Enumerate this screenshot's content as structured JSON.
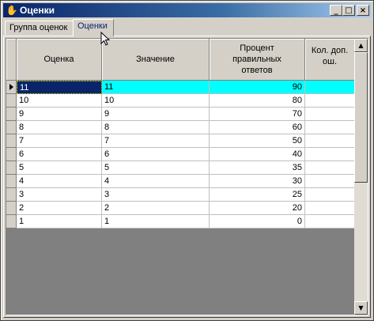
{
  "window": {
    "title": "Оценки",
    "app_icon": "hand-icon",
    "buttons": {
      "minimize": "_",
      "maximize": "□",
      "close": "×"
    }
  },
  "tabs": [
    {
      "label": "Группа оценок",
      "active": false
    },
    {
      "label": "Оценки",
      "active": true
    }
  ],
  "grid": {
    "columns": [
      {
        "label": "Оценка"
      },
      {
        "label": "Значение"
      },
      {
        "label": "Процент правильных ответов"
      },
      {
        "label": "Кол. доп. ош."
      }
    ],
    "selected_row": 0,
    "rows": [
      {
        "grade": "11",
        "value": "11",
        "percent": "90",
        "errors": ""
      },
      {
        "grade": "10",
        "value": "10",
        "percent": "80",
        "errors": ""
      },
      {
        "grade": "9",
        "value": "9",
        "percent": "70",
        "errors": ""
      },
      {
        "grade": "8",
        "value": "8",
        "percent": "60",
        "errors": ""
      },
      {
        "grade": "7",
        "value": "7",
        "percent": "50",
        "errors": ""
      },
      {
        "grade": "6",
        "value": "6",
        "percent": "40",
        "errors": ""
      },
      {
        "grade": "5",
        "value": "5",
        "percent": "35",
        "errors": ""
      },
      {
        "grade": "4",
        "value": "4",
        "percent": "30",
        "errors": ""
      },
      {
        "grade": "3",
        "value": "3",
        "percent": "25",
        "errors": ""
      },
      {
        "grade": "2",
        "value": "2",
        "percent": "20",
        "errors": ""
      },
      {
        "grade": "1",
        "value": "1",
        "percent": "0",
        "errors": ""
      }
    ]
  },
  "colors": {
    "selected_row": "#00ffff",
    "title_bar": "#0a246a",
    "focused_cell": "#0a246a"
  }
}
